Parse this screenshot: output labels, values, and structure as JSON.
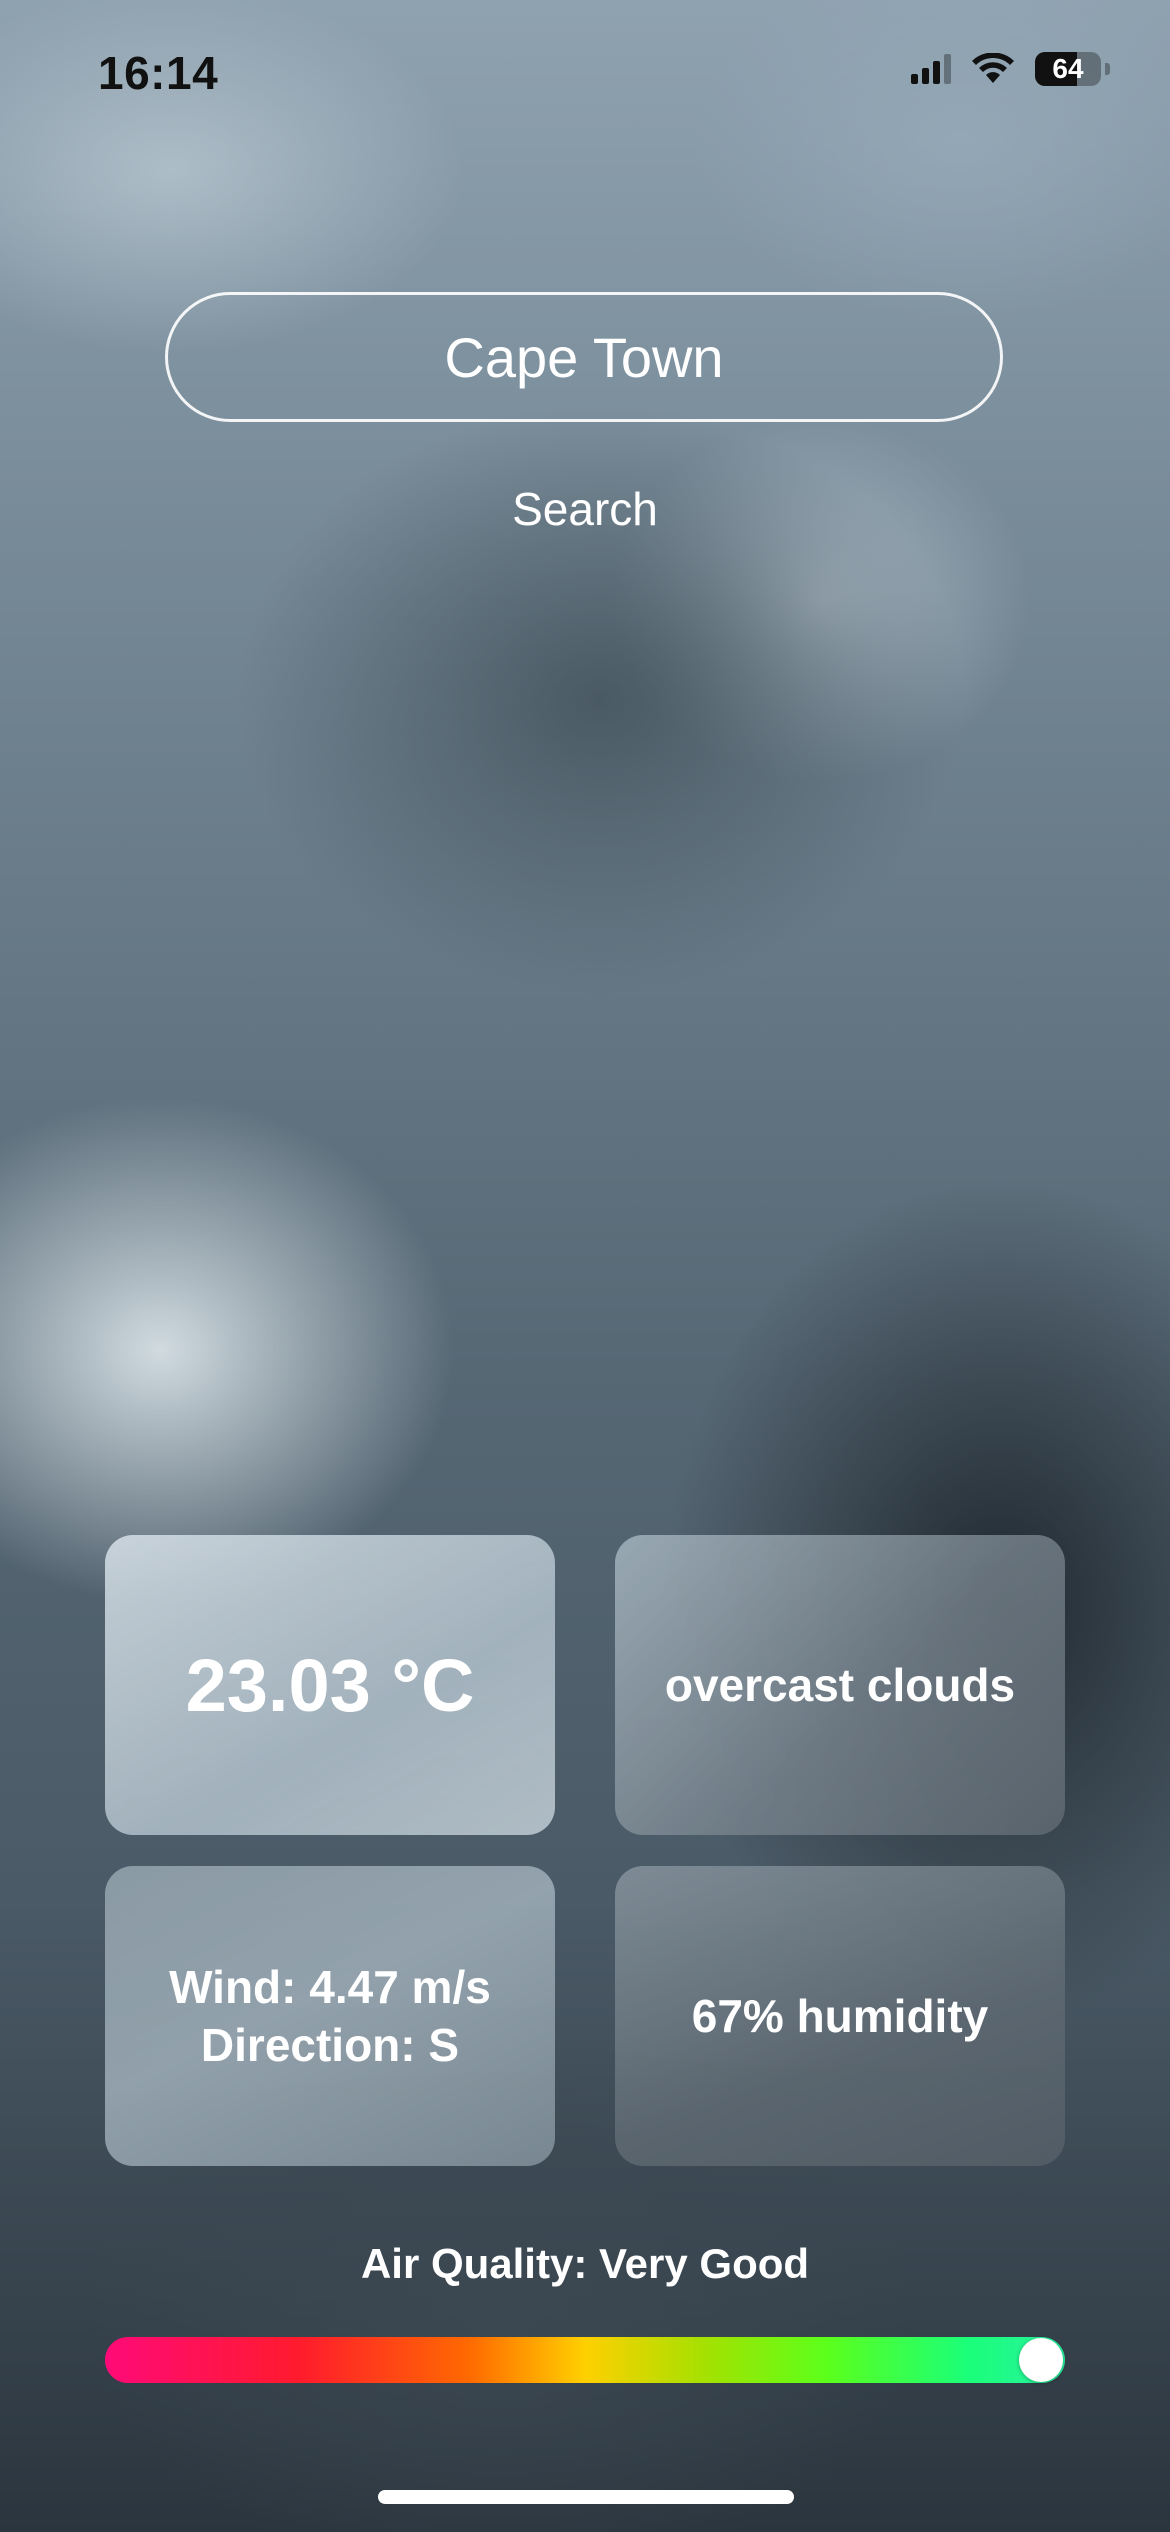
{
  "status_bar": {
    "time": "16:14",
    "battery_level": "64",
    "battery_fraction": 0.64,
    "signal_bars_active": 3,
    "signal_bars_total": 4
  },
  "search": {
    "value": "Cape Town",
    "button_label": "Search"
  },
  "weather": {
    "temperature": "23.03 °C",
    "description": "overcast clouds",
    "wind_line": "Wind: 4.47 m/s",
    "direction_line": "Direction: S",
    "humidity": "67% humidity"
  },
  "air_quality": {
    "label": "Air Quality: Very Good",
    "level_fraction": 0.98
  },
  "colors": {
    "text": "#ffffff",
    "status_text": "#111111"
  }
}
